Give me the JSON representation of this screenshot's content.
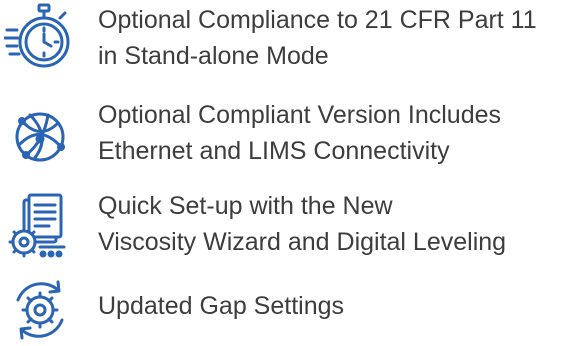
{
  "colors": {
    "icon": "#2a64b4",
    "text": "#3d3d3d",
    "background": "#ffffff"
  },
  "features": [
    {
      "icon": "stopwatch-icon",
      "lines": [
        "Optional Compliance to 21 CFR Part 11",
        "in Stand-alone Mode"
      ]
    },
    {
      "icon": "globe-network-icon",
      "lines": [
        "Optional Compliant Version Includes",
        "Ethernet and LIMS Connectivity"
      ]
    },
    {
      "icon": "document-gear-icon",
      "lines": [
        "Quick Set-up with the New",
        "Viscosity Wizard and Digital Leveling"
      ]
    },
    {
      "icon": "gear-refresh-icon",
      "lines": [
        "Updated Gap Settings"
      ]
    }
  ]
}
